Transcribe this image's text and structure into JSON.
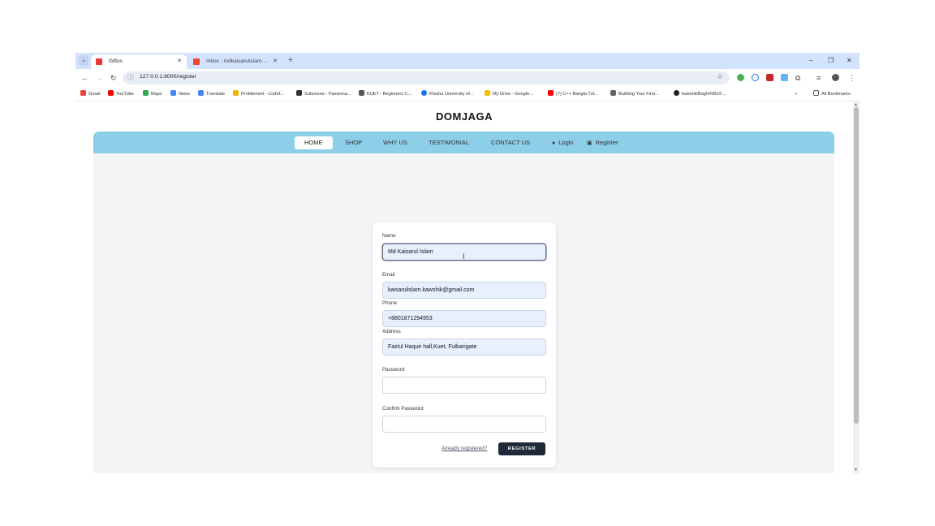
{
  "browser": {
    "tab_menu_icon": "chevron-down",
    "tabs": [
      {
        "title": "Giftos",
        "active": true
      },
      {
        "title": "Inbox - mdkaisarulislam.kawshik@...",
        "active": false
      }
    ],
    "new_tab": "+",
    "window_controls": {
      "minimize": "–",
      "restore": "❐",
      "close": "✕"
    },
    "url": "127.0.0.1:8000/register",
    "bookmarks": [
      {
        "label": "Gmail",
        "color": "#ea4335"
      },
      {
        "label": "YouTube",
        "color": "#ff0000"
      },
      {
        "label": "Maps",
        "color": "#34a853"
      },
      {
        "label": "News",
        "color": "#4285f4"
      },
      {
        "label": "Translate",
        "color": "#4285f4"
      },
      {
        "label": "Problemset - Codef...",
        "color": "#f4b400"
      },
      {
        "label": "Subscene - Passiona...",
        "color": "#333333"
      },
      {
        "label": "KUET - Beginners C...",
        "color": "#555555"
      },
      {
        "label": "Khulna University of...",
        "color": "#1a73e8"
      },
      {
        "label": "My Drive - Google...",
        "color": "#fbbc04"
      },
      {
        "label": "(7) C++ Bangla Tut...",
        "color": "#ff0000"
      },
      {
        "label": "Building Your First...",
        "color": "#666666"
      },
      {
        "label": "kawshikBagh#9810:...",
        "color": "#222222"
      }
    ],
    "bookmarks_overflow": "»",
    "all_bookmarks": "All Bookmarks"
  },
  "site": {
    "brand": "DOMJAGA",
    "nav": {
      "home": "HOME",
      "shop": "SHOP",
      "why_us": "WHY US",
      "testimonial": "TESTIMONIAL",
      "contact_us": "CONTACT US",
      "login": "Login",
      "register": "Register"
    },
    "accent_color": "#8dcee9"
  },
  "form": {
    "name_label": "Name",
    "name_value": "Md Kaisarul Islam",
    "email_label": "Email",
    "email_value": "kaisarulislam.kawshik@gmail.com",
    "phone_label": "Phone",
    "phone_value": "+8801871294953",
    "address_label": "Address",
    "address_value": "Fazlul Haque hall,Kuet, Fulbarigate",
    "password_label": "Password",
    "password_value": "",
    "confirm_label": "Confirm Password",
    "confirm_value": "",
    "already_link": "Already registered?",
    "submit_label": "REGISTER"
  }
}
